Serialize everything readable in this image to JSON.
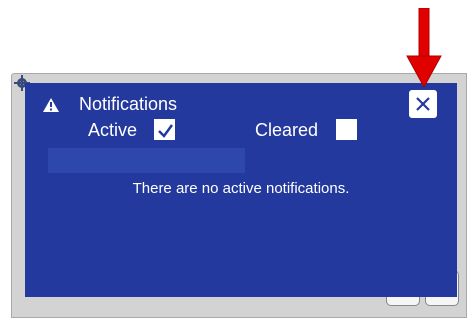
{
  "dialog": {
    "title": "Notifications",
    "filters": {
      "active_label": "Active",
      "active_checked": true,
      "cleared_label": "Cleared",
      "cleared_checked": false
    },
    "empty_message": "There are no active notifications."
  },
  "icons": {
    "warning": "warning-triangle-icon",
    "close": "close-icon",
    "settings": "gear-icon",
    "annotation": "red-down-arrow-icon"
  },
  "colors": {
    "dialog_bg": "#23399d",
    "dialog_bar": "#2d47ad",
    "text": "#ffffff",
    "arrow": "#e00000"
  }
}
